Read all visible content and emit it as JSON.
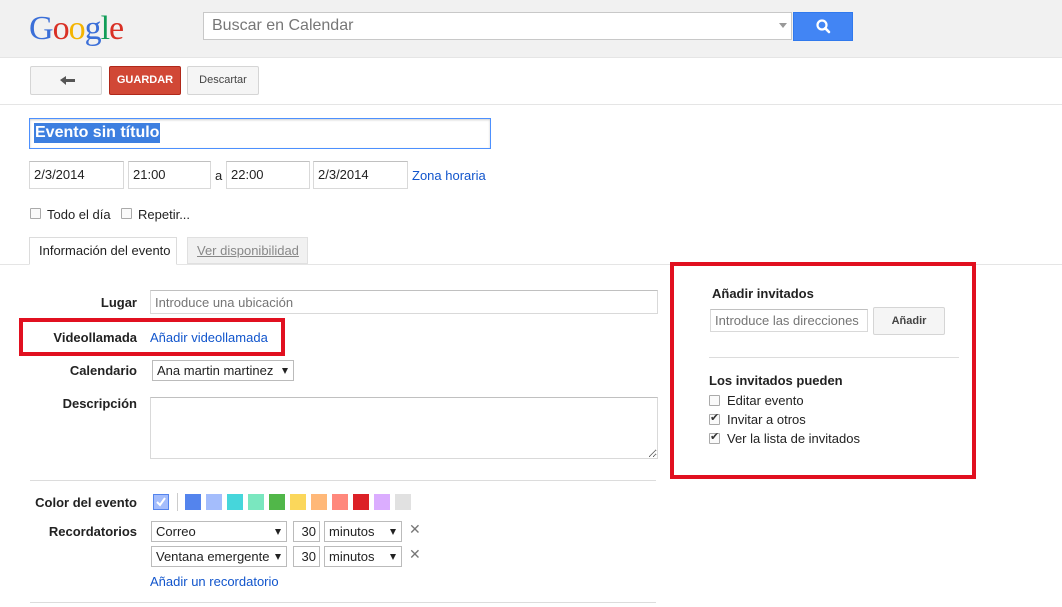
{
  "header": {
    "logo_text": "Google",
    "search_placeholder": "Buscar en Calendar",
    "search_icon": "magnifier-icon",
    "accent_color": "#4285f4"
  },
  "toolbar": {
    "back_icon": "back-arrow-icon",
    "save_label": "GUARDAR",
    "discard_label": "Descartar",
    "save_color": "#d14836"
  },
  "event": {
    "title": "Evento sin título",
    "start_date": "2/3/2014",
    "start_time": "21:00",
    "to_label": "a",
    "end_time": "22:00",
    "end_date": "2/3/2014",
    "timezone_link": "Zona horaria",
    "all_day_label": "Todo el día",
    "all_day_checked": false,
    "repeat_label": "Repetir...",
    "repeat_checked": false
  },
  "tabs": [
    {
      "label": "Información del evento",
      "active": true
    },
    {
      "label": "Ver disponibilidad",
      "active": false
    }
  ],
  "details": {
    "location_label": "Lugar",
    "location_placeholder": "Introduce una ubicación",
    "videocall_label": "Videollamada",
    "videocall_link": "Añadir videollamada",
    "calendar_label": "Calendario",
    "calendar_value": "Ana martin martinez",
    "description_label": "Descripción",
    "color_label": "Color del evento",
    "colors": [
      "#a4bdfc",
      "#5484ed",
      "#a4bdfc",
      "#46d6db",
      "#7ae7bf",
      "#51b749",
      "#fbd75b",
      "#ffb878",
      "#ff887c",
      "#dc2127",
      "#dbadff",
      "#e1e1e1"
    ],
    "reminders_label": "Recordatorios",
    "reminders": [
      {
        "type": "Correo",
        "amount": "30",
        "unit": "minutos"
      },
      {
        "type": "Ventana emergente",
        "amount": "30",
        "unit": "minutos"
      }
    ],
    "add_reminder_link": "Añadir un recordatorio"
  },
  "guests": {
    "title": "Añadir invitados",
    "input_placeholder": "Introduce las direcciones",
    "add_button": "Añadir",
    "permissions_title": "Los invitados pueden",
    "permissions": [
      {
        "label": "Editar evento",
        "checked": false
      },
      {
        "label": "Invitar a otros",
        "checked": true
      },
      {
        "label": "Ver la lista de invitados",
        "checked": true
      }
    ]
  },
  "annotation_color": "#e11020"
}
